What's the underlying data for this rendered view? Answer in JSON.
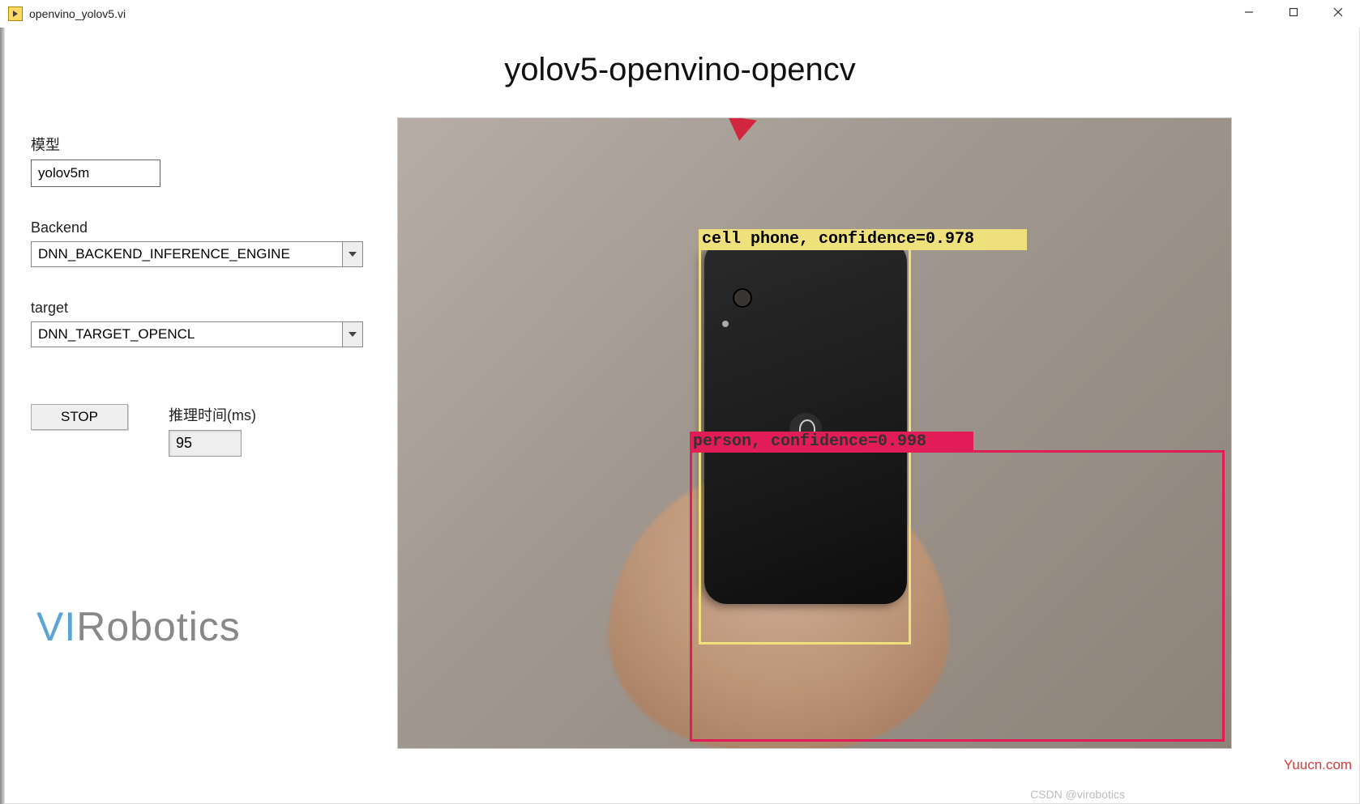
{
  "window": {
    "title": "openvino_yolov5.vi"
  },
  "header": {
    "title": "yolov5-openvino-opencv"
  },
  "sidebar": {
    "model_label": "模型",
    "model_value": "yolov5m",
    "backend_label": "Backend",
    "backend_value": "DNN_BACKEND_INFERENCE_ENGINE",
    "target_label": "target",
    "target_value": "DNN_TARGET_OPENCL",
    "stop_label": "STOP",
    "timer_label": "推理时间(ms)",
    "timer_value": "95"
  },
  "detections": {
    "cell_phone": "cell phone, confidence=0.978",
    "person": "person, confidence=0.998"
  },
  "logo": {
    "v": "V",
    "i": "I",
    "rest": "Robotics"
  },
  "watermarks": {
    "yuucn": "Yuucn.com",
    "csdn": "CSDN @virobotics"
  }
}
